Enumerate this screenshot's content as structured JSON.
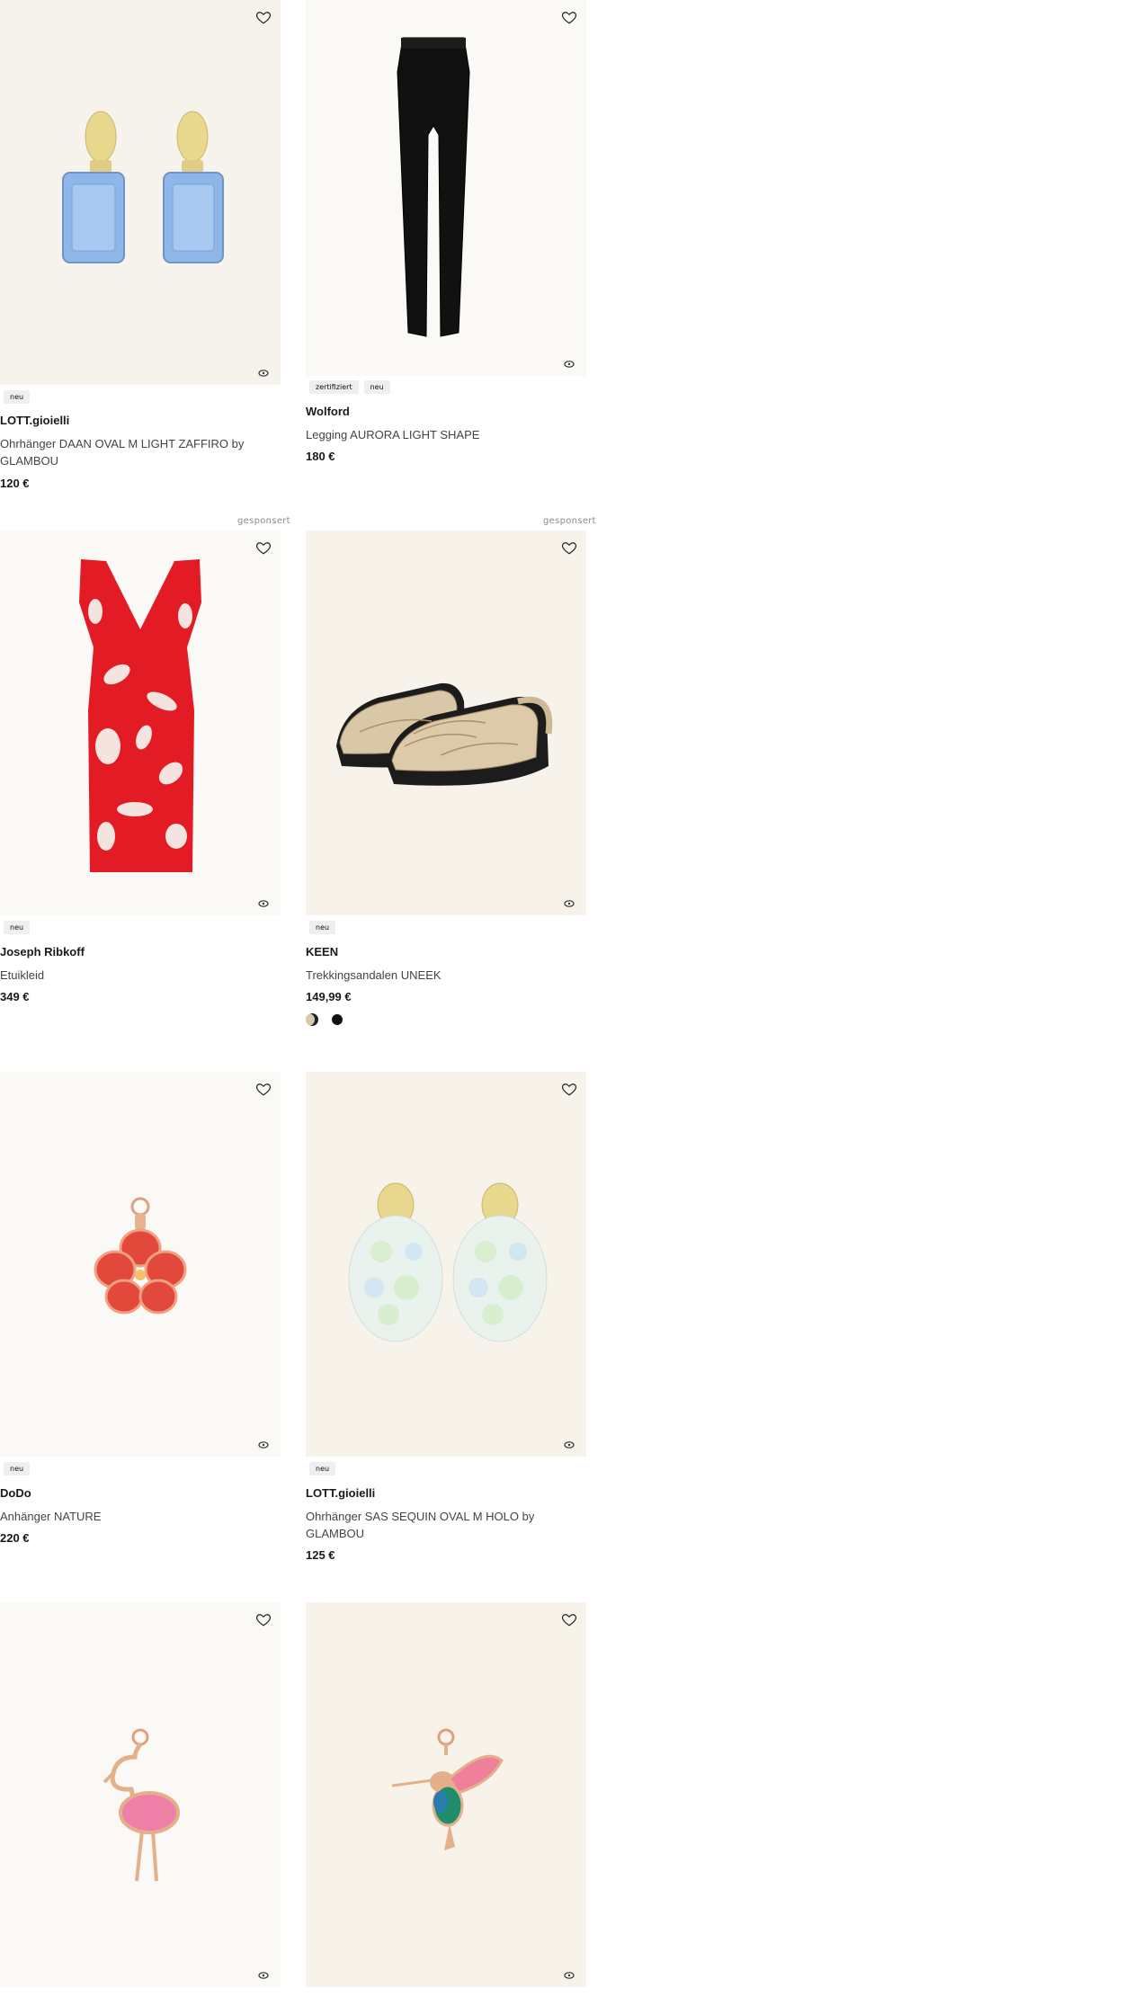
{
  "products": [
    {
      "brand": "LOTT.gioielli",
      "title": "Ohrhänger DAAN OVAL M LIGHT ZAFFIRO by GLAMBOU",
      "price": "120 €",
      "badges": [
        "neu"
      ],
      "image": "blue-crystal-earrings"
    },
    {
      "brand": "Wolford",
      "title": "Legging AURORA LIGHT SHAPE",
      "price": "180 €",
      "badges": [
        "zertifiziert",
        "neu"
      ],
      "image": "black-leggings"
    },
    {
      "brand": "Joseph Ribkoff",
      "title": "Etuikleid",
      "price": "349 €",
      "badges": [
        "neu"
      ],
      "sponsored": "gesponsert",
      "image": "red-floral-dress"
    },
    {
      "brand": "KEEN",
      "title": "Trekkingsandalen UNEEK",
      "price": "149,99 €",
      "badges": [
        "neu"
      ],
      "sponsored": "gesponsert",
      "image": "beige-trekking-sandals",
      "swatches": [
        "#d7c9b0",
        "#111111"
      ]
    },
    {
      "brand": "DoDo",
      "title": "Anhänger NATURE",
      "price": "220 €",
      "badges": [
        "neu"
      ],
      "image": "hibiscus-pendant"
    },
    {
      "brand": "LOTT.gioielli",
      "title": "Ohrhänger SAS SEQUIN OVAL M HOLO by GLAMBOU",
      "price": "125 €",
      "badges": [
        "neu"
      ],
      "image": "holo-sequin-earrings"
    },
    {
      "image": "flamingo-pendant"
    },
    {
      "image": "hummingbird-pendant"
    }
  ],
  "icons": {
    "wishlist": "heart-outline-icon",
    "zoom": "zoom-icon"
  }
}
